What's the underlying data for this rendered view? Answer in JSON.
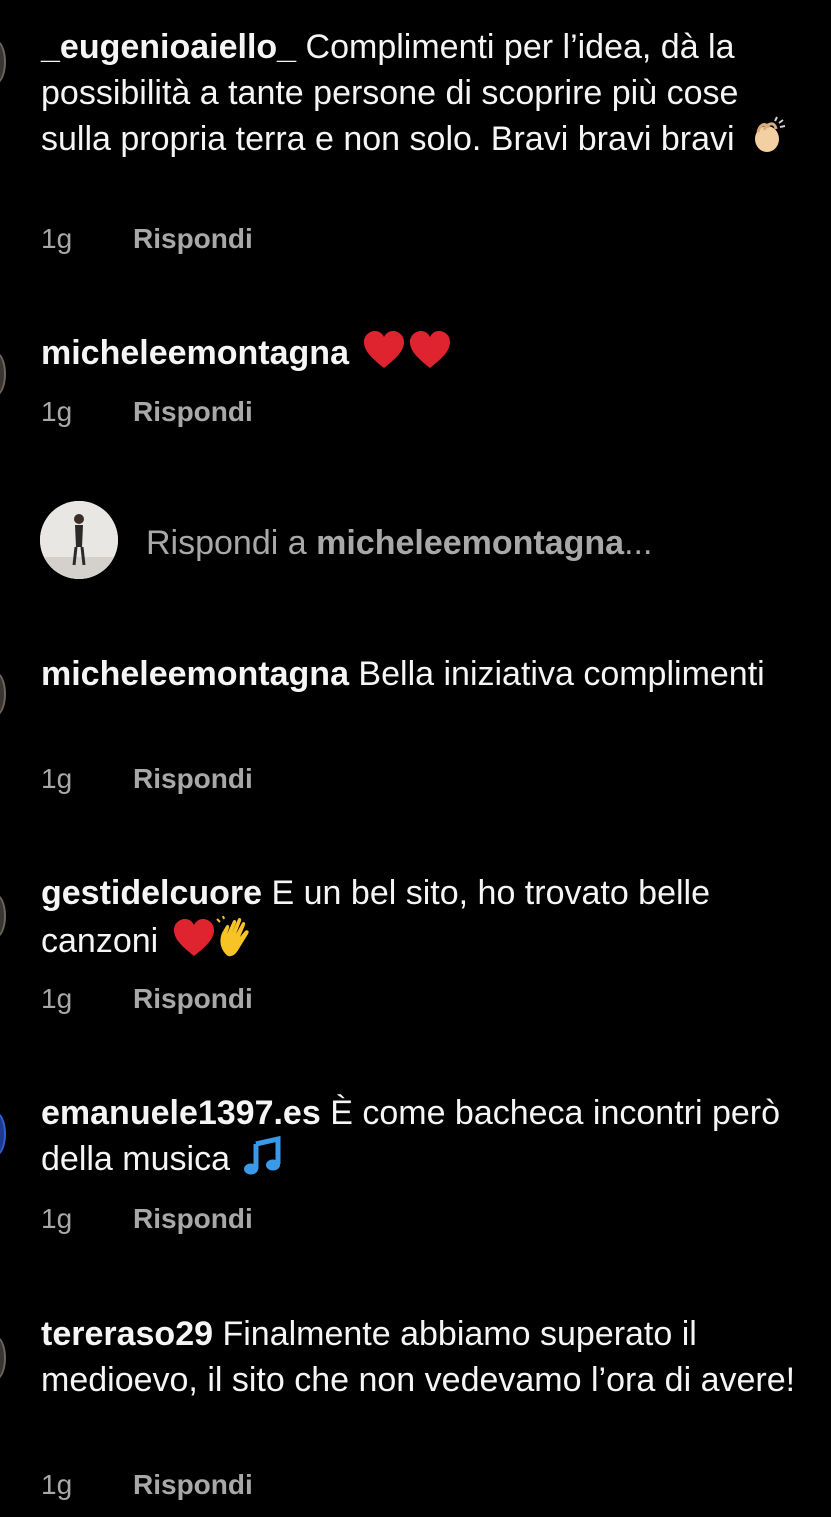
{
  "comments": [
    {
      "username": "_eugenioaiello_",
      "text": " Complimenti per l’idea, dà la possibilità a tante persone di scoprire più cose sulla propria terra e non solo. Bravi bravi bravi",
      "emojis": [
        "clapping-hands-icon"
      ],
      "age": "1g",
      "reply_label": "Rispondi"
    },
    {
      "username": "micheleemontagna",
      "text": "",
      "emojis": [
        "red-heart-icon",
        "red-heart-icon"
      ],
      "age": "1g",
      "reply_label": "Rispondi"
    },
    {
      "username": "micheleemontagna",
      "text": " Bella iniziativa complimenti",
      "emojis": [],
      "age": "1g",
      "reply_label": "Rispondi"
    },
    {
      "username": "gestidelcuore",
      "text": " E un bel sito, ho trovato belle canzoni",
      "emojis": [
        "red-heart-icon",
        "waving-hand-icon"
      ],
      "age": "1g",
      "reply_label": "Rispondi"
    },
    {
      "username": "emanuele1397.es",
      "text": " È come bacheca incontri però della musica",
      "emojis": [
        "music-note-icon"
      ],
      "age": "1g",
      "reply_label": "Rispondi"
    },
    {
      "username": "tereraso29",
      "text": " Finalmente abbiamo superato il medioevo, il sito che non vedevamo l’ora di avere!",
      "emojis": [],
      "age": "1g",
      "reply_label": "Rispondi"
    }
  ],
  "reply_box": {
    "prefix": "Rispondi a ",
    "username": "micheleemontagna",
    "suffix": "..."
  },
  "colors": {
    "background": "#000000",
    "text": "#f5f5f5",
    "secondary_text": "#a8a8a8",
    "heart": "#e0242f",
    "clap": "#f2d0a4",
    "wave": "#f7c325",
    "note": "#3b9ae8"
  }
}
